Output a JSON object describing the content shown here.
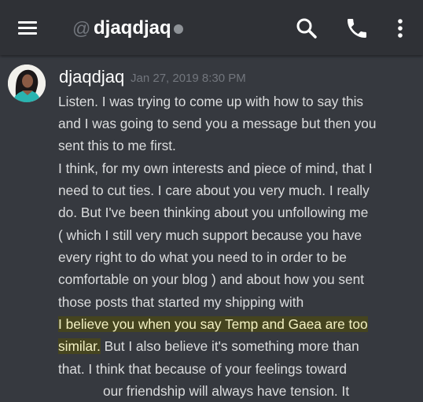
{
  "header": {
    "at_symbol": "@",
    "title": "djaqdjaq",
    "status_color": "#8e9297",
    "menu_icon": "hamburger-menu-icon",
    "search_icon": "search-icon",
    "call_icon": "phone-icon",
    "more_icon": "more-vertical-icon"
  },
  "message": {
    "author": "djaqdjaq",
    "timestamp": "Jan 27, 2019 8:30 PM",
    "lines": [
      "Listen. I was trying to come up with how to say this",
      "and I was going to send you a message but then you",
      "sent this to me first.",
      "I think, for my own interests and piece of mind, that I",
      "need to cut ties. I care about you very much. I really",
      "do. But I've been thinking about you unfollowing me",
      "( which I still very much support because you have",
      "every right to do what you need to in order to be",
      "comfortable on your blog ) and about how you sent",
      "those posts that started my shipping with"
    ],
    "highlight_line_1": "I believe you when you say Temp and Gaea are too",
    "highlight_line_2": "similar.",
    "line_after_highlight": " But I also believe it's something more than",
    "line_12": "that. I think that because of your feelings toward",
    "line_13": "our friendship will always have tension. It"
  },
  "colors": {
    "background": "#36393f",
    "header": "#2f3136",
    "text": "#dcddde",
    "muted": "#72767d",
    "highlight_bg": "#45441f",
    "highlight_text": "#f3f1c4"
  }
}
